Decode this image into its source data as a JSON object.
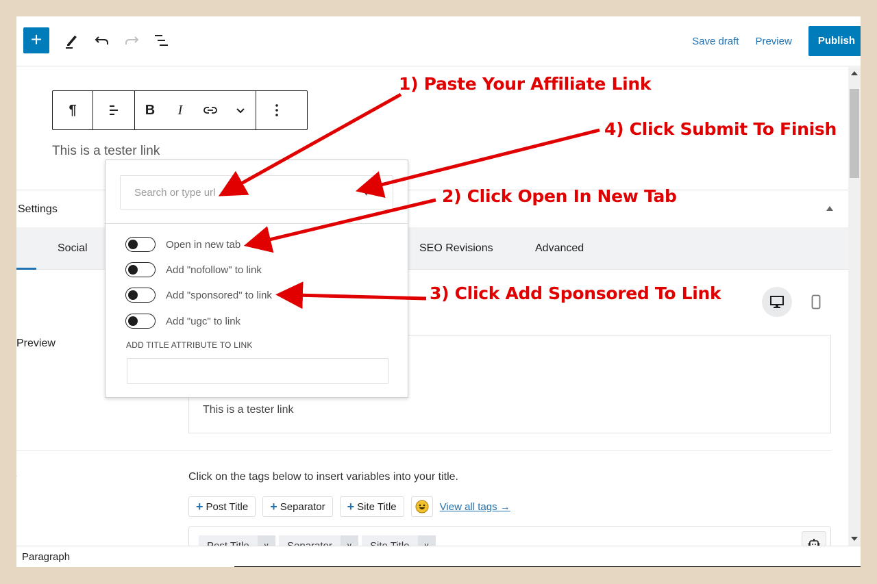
{
  "toolbar": {
    "add_block_label": "+",
    "save_draft": "Save draft",
    "preview": "Preview",
    "publish": "Publish"
  },
  "editor": {
    "block_toolbar": {
      "paragraph": "¶",
      "bold": "B",
      "italic": "I"
    },
    "paragraph_text": "This is a tester link"
  },
  "link_popover": {
    "url_placeholder": "Search or type url",
    "toggles": [
      {
        "label": "Open in new tab",
        "on": false
      },
      {
        "label": "Add \"nofollow\" to link",
        "on": false
      },
      {
        "label": "Add \"sponsored\" to link",
        "on": false
      },
      {
        "label": "Add \"ugc\" to link",
        "on": false
      }
    ],
    "title_attribute_label": "ADD TITLE ATTRIBUTE TO LINK",
    "title_attribute_value": ""
  },
  "settings": {
    "title": "Settings",
    "tabs": [
      "Social",
      "SEO Revisions",
      "Advanced"
    ],
    "active_tab": "Social",
    "preview_label": "Preview",
    "preview_text": "This is a tester link",
    "title_label_partial": "e",
    "help_text": "Click on the tags below to insert variables into your title.",
    "tag_buttons": [
      "Post Title",
      "Separator",
      "Site Title"
    ],
    "view_all_tags": "View all tags →",
    "title_tokens": [
      "Post Title",
      "Separator",
      "Site Title"
    ]
  },
  "statusbar": {
    "block_type": "Paragraph"
  },
  "annotations": {
    "step1": "1) Paste Your Affiliate Link",
    "step2": "2) Click Open In New Tab",
    "step3": "3) Click Add Sponsored To Link",
    "step4": "4) Click Submit To Finish",
    "color": "#e00000"
  },
  "colors": {
    "accent": "#007cba",
    "background": "#e6d7c3"
  }
}
